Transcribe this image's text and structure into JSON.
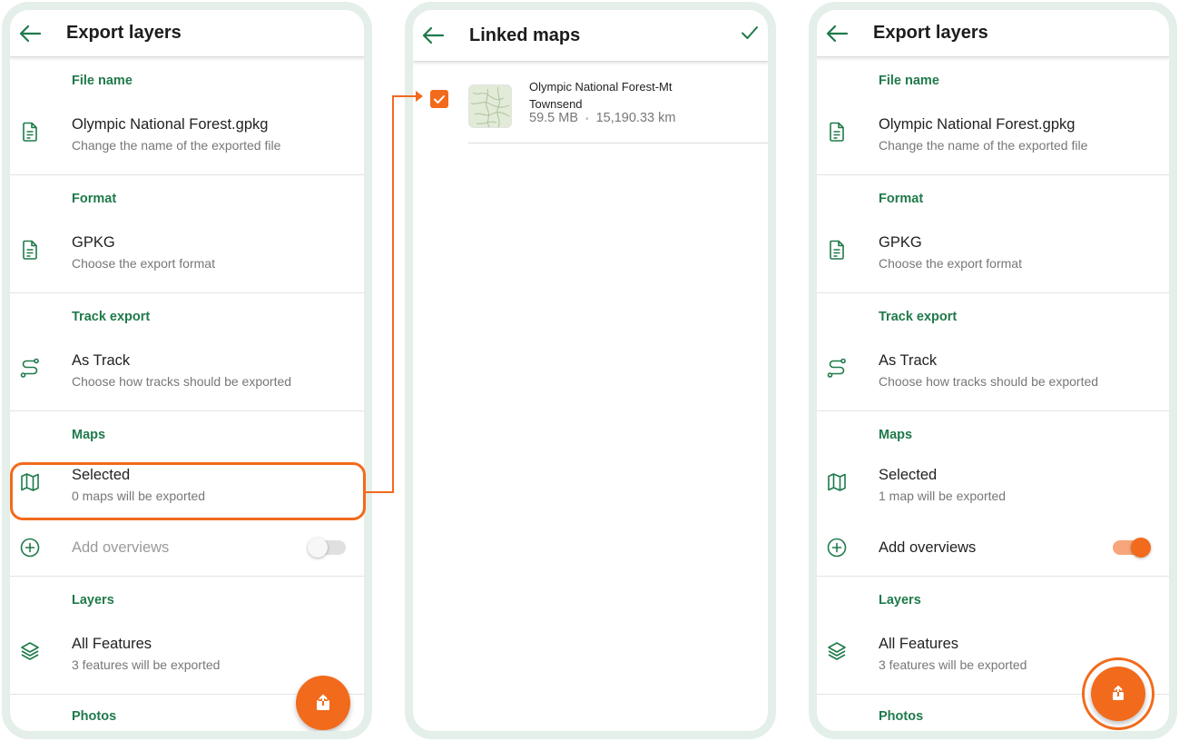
{
  "colors": {
    "accent": "#f26a1b",
    "section_green": "#1f7a4a",
    "frame": "#e4efe9"
  },
  "screen1": {
    "title": "Export layers",
    "sections": {
      "file_name": "File name",
      "format": "Format",
      "track_export": "Track export",
      "maps": "Maps",
      "layers": "Layers",
      "photos": "Photos"
    },
    "file": {
      "primary": "Olympic National Forest.gpkg",
      "secondary": "Change the name of the exported file",
      "icon": "document-icon"
    },
    "format_item": {
      "primary": "GPKG",
      "secondary": "Choose the export format",
      "icon": "document-icon"
    },
    "track_item": {
      "primary": "As Track",
      "secondary": "Choose how tracks should be exported",
      "icon": "route-icon"
    },
    "maps_item": {
      "primary": "Selected",
      "secondary": "0 maps will be exported",
      "icon": "map-icon"
    },
    "overviews": {
      "label": "Add overviews",
      "enabled": false,
      "icon": "plus-circle-icon"
    },
    "layers_item": {
      "primary": "All Features",
      "secondary": "3 features will be exported",
      "icon": "layers-icon"
    }
  },
  "screen2": {
    "title": "Linked maps",
    "map": {
      "title": "Olympic National Forest-Mt Townsend",
      "size": "59.5 MB",
      "separator": "•",
      "area": "15,190.33 km",
      "checked": true
    }
  },
  "screen3": {
    "title": "Export layers",
    "sections": {
      "file_name": "File name",
      "format": "Format",
      "track_export": "Track export",
      "maps": "Maps",
      "layers": "Layers",
      "photos": "Photos"
    },
    "file": {
      "primary": "Olympic National Forest.gpkg",
      "secondary": "Change the name of the exported file"
    },
    "format_item": {
      "primary": "GPKG",
      "secondary": "Choose the export format"
    },
    "track_item": {
      "primary": "As Track",
      "secondary": "Choose how tracks should be exported"
    },
    "maps_item": {
      "primary": "Selected",
      "secondary": "1 map will be exported"
    },
    "overviews": {
      "label": "Add overviews",
      "enabled": true
    },
    "layers_item": {
      "primary": "All Features",
      "secondary": "3 features will be exported"
    }
  }
}
